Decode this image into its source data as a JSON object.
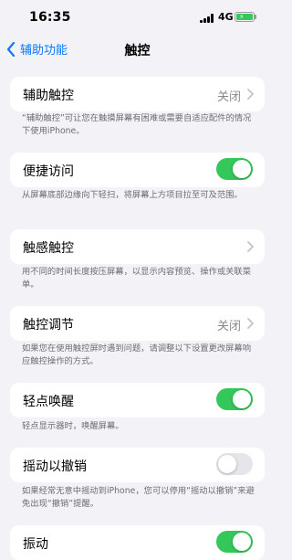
{
  "status_bar": {
    "time": "16:35",
    "network": "4G"
  },
  "nav": {
    "back_label": "辅助功能",
    "title": "触控"
  },
  "rows": [
    {
      "label": "辅助触控",
      "value": "关闭",
      "footnote": "“辅助触控”可让您在触摸屏幕有困难或需要自适应配件的情况下使用iPhone。"
    },
    {
      "label": "便捷访问",
      "toggle": true,
      "footnote": "从屏幕底部边缘向下轻扫，将屏幕上方项目拉至可及范围。"
    },
    {
      "label": "触感触控",
      "footnote": "用不同的时间长度按压屏幕，以显示内容预览、操作或关联菜单。"
    },
    {
      "label": "触控调节",
      "value": "关闭",
      "footnote": "如果您在使用触控屏时遇到问题，请调整以下设置更改屏幕响应触控操作的方式。"
    },
    {
      "label": "轻点唤醒",
      "toggle": true,
      "footnote": "轻点显示器时，唤醒屏幕。"
    },
    {
      "label": "摇动以撤销",
      "toggle": false,
      "footnote": "如果经常无意中摇动到iPhone，您可以停用“摇动以撤销”来避免出现“撤销”提醒。"
    },
    {
      "label": "振动",
      "toggle": true
    }
  ],
  "colors": {
    "accent": "#0a7aff",
    "toggle_on": "#34c759",
    "toggle_off": "#e6e6ea",
    "background": "#f2f2f7"
  }
}
